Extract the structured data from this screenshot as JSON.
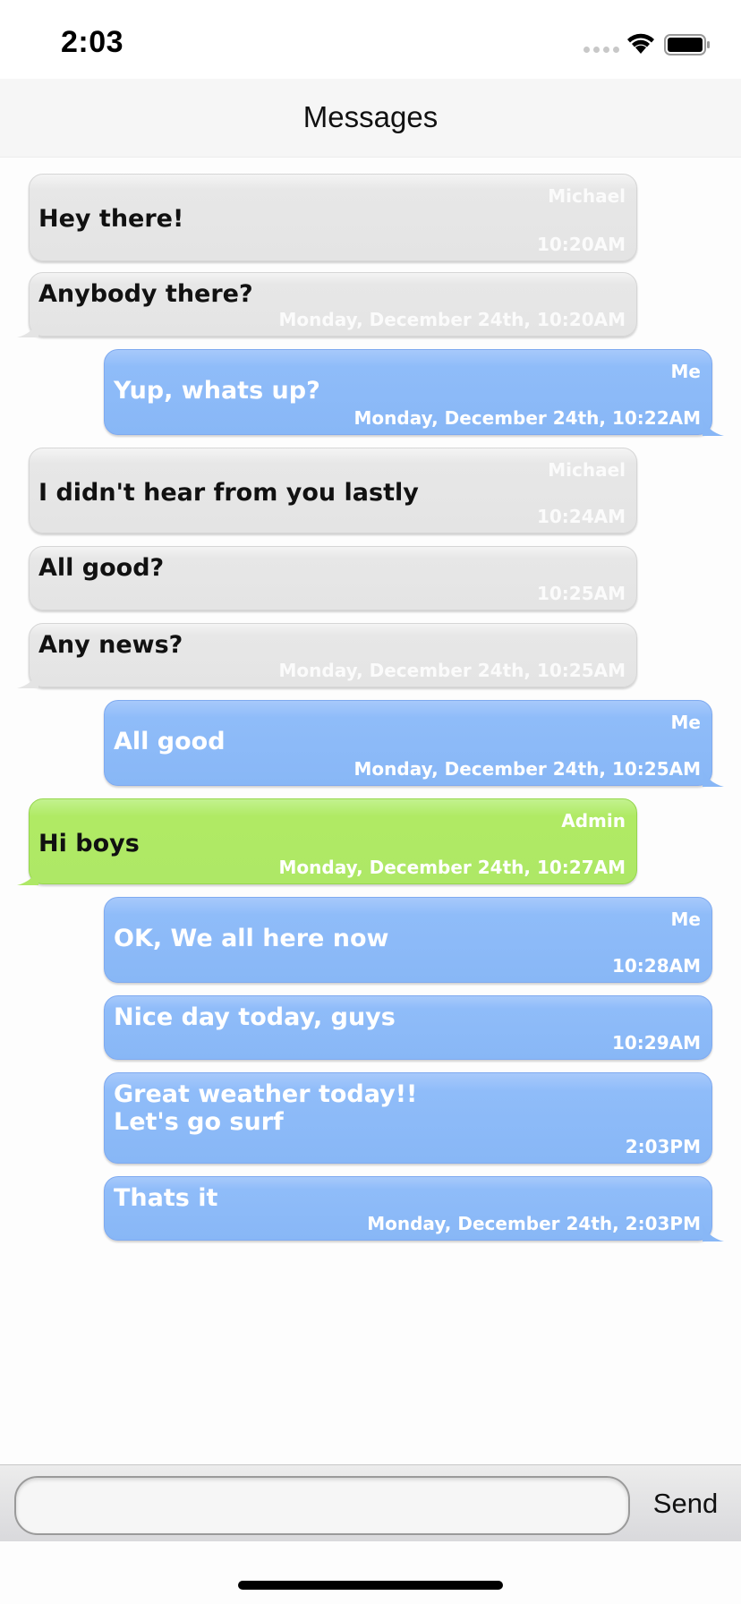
{
  "status_bar": {
    "time": "2:03"
  },
  "nav": {
    "title": "Messages"
  },
  "messages": [
    {
      "kind": "in",
      "text": "Hey there!",
      "name": "Michael",
      "time": "10:20AM"
    },
    {
      "kind": "in",
      "text": "Anybody there?",
      "name": "",
      "time": "Monday, December 24th, 10:20AM",
      "tail": true
    },
    {
      "kind": "out",
      "text": "Yup, whats up?",
      "name": "Me",
      "time": "Monday, December 24th, 10:22AM",
      "tail": true
    },
    {
      "kind": "in",
      "text": "I didn't hear from you lastly",
      "name": "Michael",
      "time": "10:24AM"
    },
    {
      "kind": "in",
      "text": "All good?",
      "name": "",
      "time": "10:25AM"
    },
    {
      "kind": "in",
      "text": "Any news?",
      "name": "",
      "time": "Monday, December 24th, 10:25AM",
      "tail": true
    },
    {
      "kind": "out",
      "text": "All good",
      "name": "Me",
      "time": "Monday, December 24th, 10:25AM",
      "tail": true
    },
    {
      "kind": "admin",
      "text": "Hi boys",
      "name": "Admin",
      "time": "Monday, December 24th, 10:27AM",
      "tail": true
    },
    {
      "kind": "out",
      "text": "OK, We all here now",
      "name": "Me",
      "time": "10:28AM"
    },
    {
      "kind": "out",
      "text": "Nice day today, guys",
      "name": "",
      "time": "10:29AM"
    },
    {
      "kind": "out",
      "text": "Great weather today!!\nLet's go surf",
      "name": "",
      "time": "2:03PM"
    },
    {
      "kind": "out",
      "text": "Thats it",
      "name": "",
      "time": "Monday, December 24th, 2:03PM",
      "tail": true
    }
  ],
  "input": {
    "value": "",
    "placeholder": ""
  },
  "send_label": "Send",
  "colors": {
    "incoming": "#e5e5e5",
    "outgoing": "#89b8f7",
    "admin": "#afe865"
  }
}
